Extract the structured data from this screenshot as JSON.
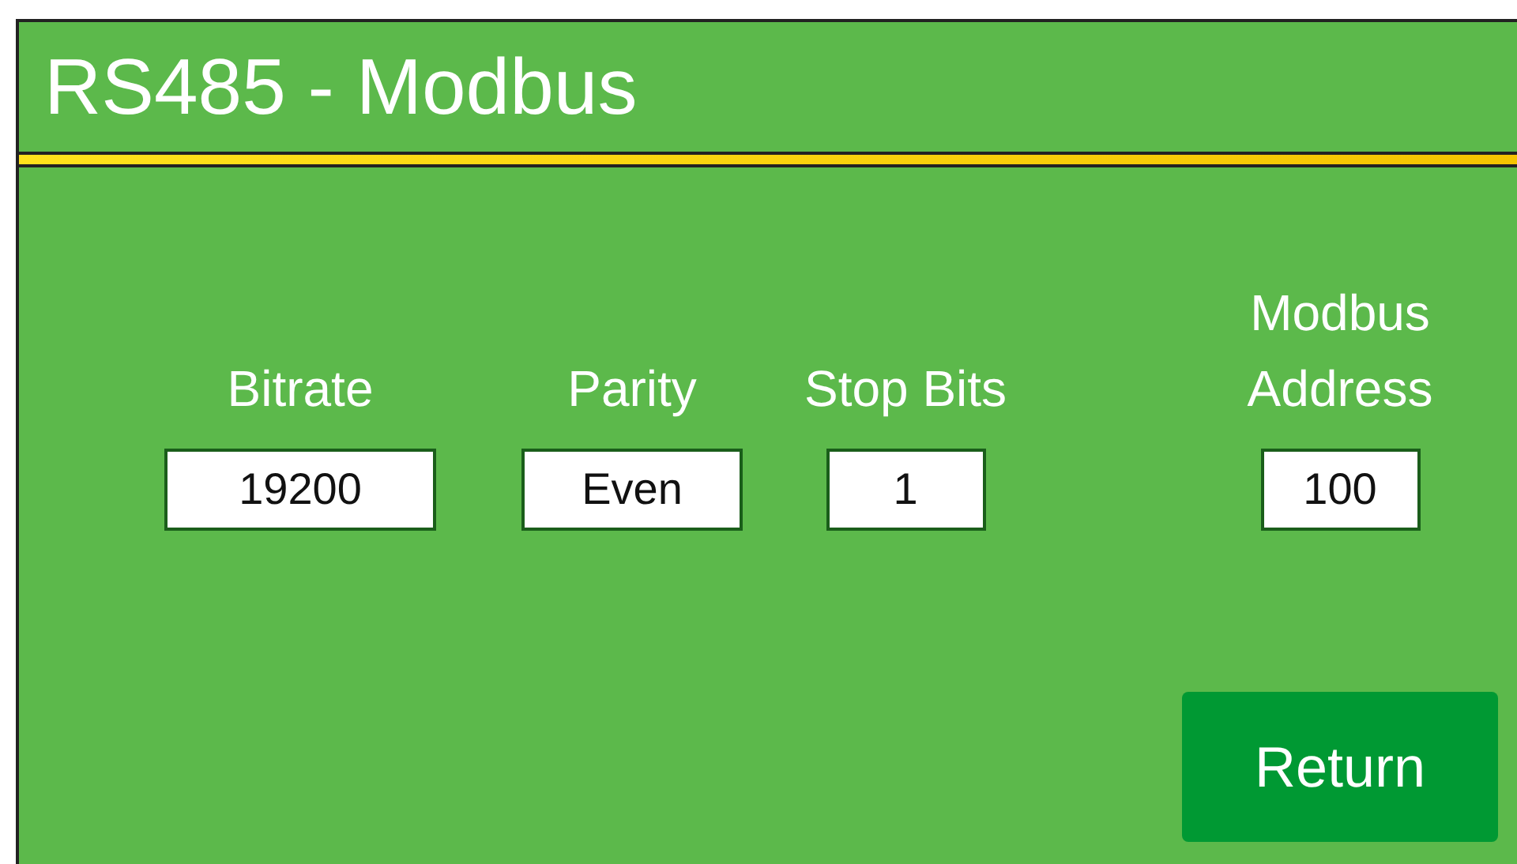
{
  "title": "RS485 - Modbus",
  "fields": [
    {
      "label": "Bitrate",
      "value": "19200"
    },
    {
      "label": "Parity",
      "value": "Even"
    },
    {
      "label": "Stop Bits",
      "value": "1"
    },
    {
      "label": "Modbus Address",
      "value": "100"
    }
  ],
  "return_button": "Return"
}
